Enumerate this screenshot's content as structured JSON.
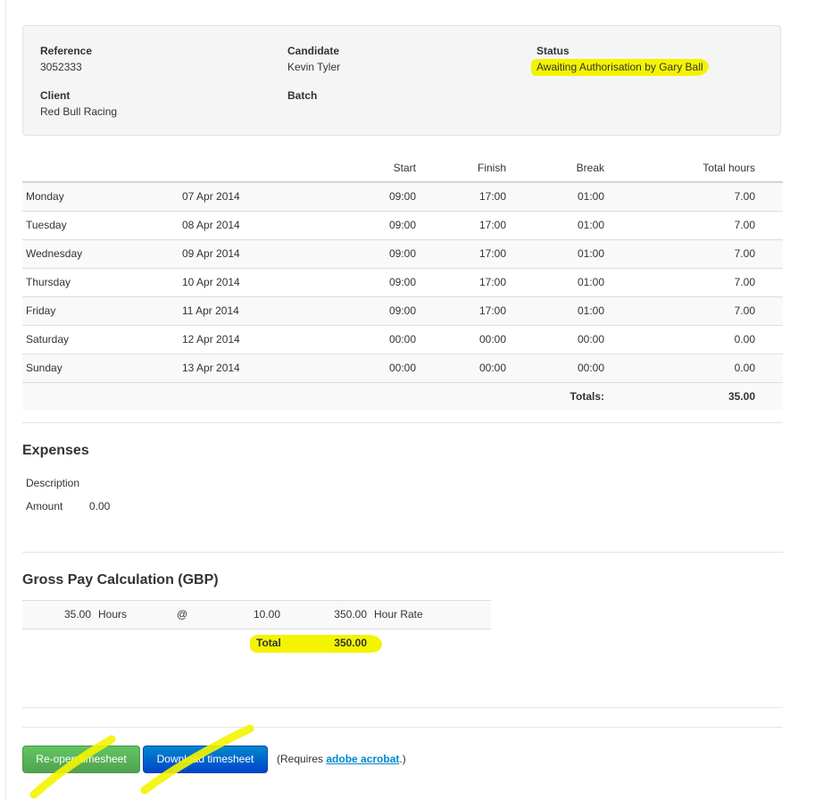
{
  "info": {
    "reference_label": "Reference",
    "reference_value": "3052333",
    "candidate_label": "Candidate",
    "candidate_value": "Kevin Tyler",
    "status_label": "Status",
    "status_value": "Awaiting Authorisation by Gary Ball",
    "client_label": "Client",
    "client_value": "Red Bull Racing",
    "batch_label": "Batch"
  },
  "timesheet": {
    "headers": {
      "start": "Start",
      "finish": "Finish",
      "break": "Break",
      "total": "Total hours"
    },
    "rows": [
      {
        "day": "Monday",
        "date": "07 Apr 2014",
        "start": "09:00",
        "finish": "17:00",
        "break": "01:00",
        "total": "7.00"
      },
      {
        "day": "Tuesday",
        "date": "08 Apr 2014",
        "start": "09:00",
        "finish": "17:00",
        "break": "01:00",
        "total": "7.00"
      },
      {
        "day": "Wednesday",
        "date": "09 Apr 2014",
        "start": "09:00",
        "finish": "17:00",
        "break": "01:00",
        "total": "7.00"
      },
      {
        "day": "Thursday",
        "date": "10 Apr 2014",
        "start": "09:00",
        "finish": "17:00",
        "break": "01:00",
        "total": "7.00"
      },
      {
        "day": "Friday",
        "date": "11 Apr 2014",
        "start": "09:00",
        "finish": "17:00",
        "break": "01:00",
        "total": "7.00"
      },
      {
        "day": "Saturday",
        "date": "12 Apr 2014",
        "start": "00:00",
        "finish": "00:00",
        "break": "00:00",
        "total": "0.00"
      },
      {
        "day": "Sunday",
        "date": "13 Apr 2014",
        "start": "00:00",
        "finish": "00:00",
        "break": "00:00",
        "total": "0.00"
      }
    ],
    "totals_label": "Totals:",
    "totals_value": "35.00"
  },
  "expenses": {
    "title": "Expenses",
    "description_label": "Description",
    "amount_label": "Amount",
    "amount_value": "0.00"
  },
  "gross_pay": {
    "title": "Gross Pay Calculation (GBP)",
    "hours": "35.00",
    "hours_label": "Hours",
    "at": "@",
    "rate": "10.00",
    "amount": "350.00",
    "rate_label": "Hour Rate",
    "total_label": "Total",
    "total_value": "350.00"
  },
  "footer": {
    "reopen_label": "Re-open timesheet",
    "download_label": "Download timesheet",
    "requires_prefix": "(Requires ",
    "requires_link": "adobe acrobat",
    "requires_suffix": ".)"
  },
  "colors": {
    "highlight": "#f4f400",
    "button_green": "#5bb75b",
    "button_blue": "#0074cc",
    "link": "#0088cc"
  }
}
